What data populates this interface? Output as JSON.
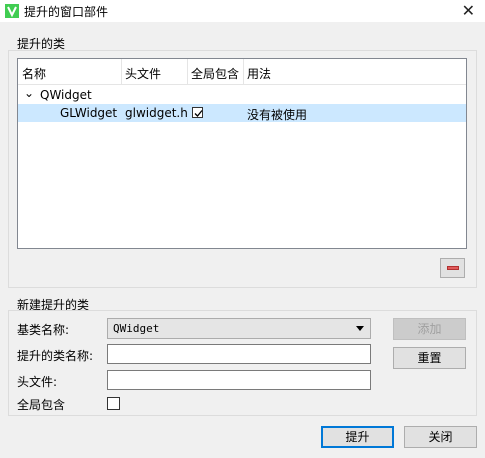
{
  "window": {
    "title": "提升的窗口部件",
    "close_glyph": "✕"
  },
  "promoted_group": {
    "label": "提升的类",
    "columns": [
      "名称",
      "头文件",
      "全局包含",
      "用法"
    ],
    "tree": {
      "base_class": "QWidget",
      "expand_glyph": "⌄",
      "children": [
        {
          "name": "GLWidget",
          "header": "glwidget.h",
          "global_include": true,
          "usage": "没有被使用"
        }
      ]
    }
  },
  "new_group": {
    "label": "新建提升的类",
    "base_class_label": "基类名称:",
    "base_class_value": "QWidget",
    "class_name_label": "提升的类名称:",
    "class_name_value": "",
    "header_label": "头文件:",
    "header_value": "",
    "global_include_label": "全局包含",
    "global_include_checked": false,
    "add_button": "添加",
    "reset_button": "重置"
  },
  "footer": {
    "promote_button": "提升",
    "close_button": "关闭"
  },
  "colors": {
    "selection": "#cce8ff",
    "accent": "#0078d7",
    "remove": "#e15a5a"
  }
}
